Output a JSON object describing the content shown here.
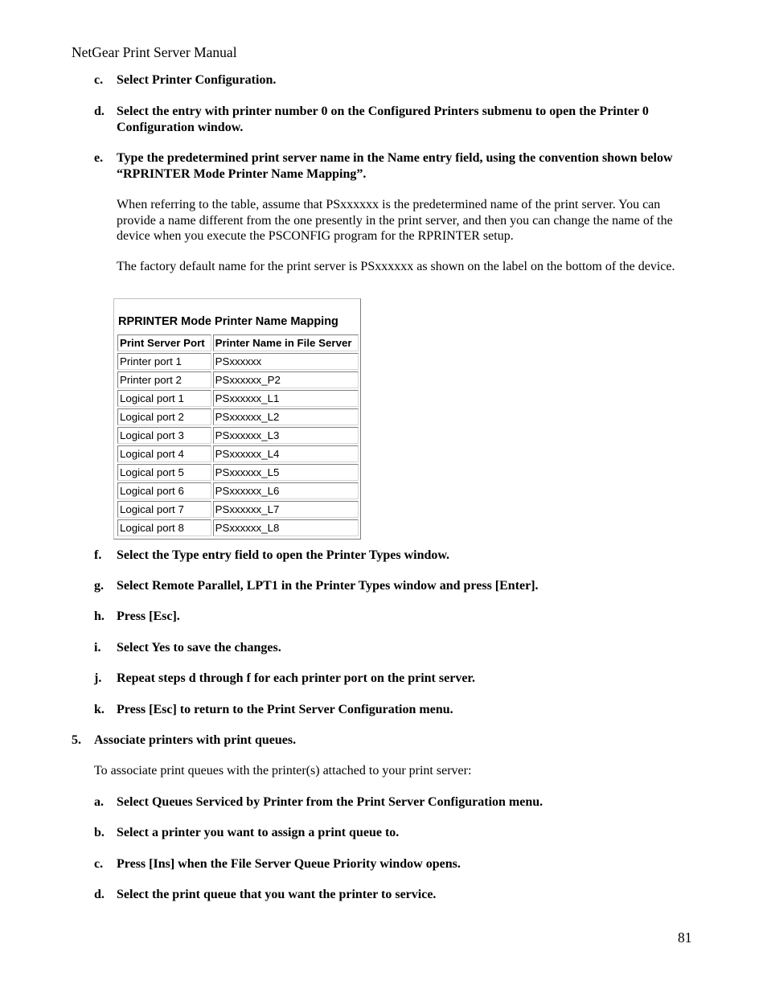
{
  "header": "NetGear Print Server Manual",
  "steps_top": [
    {
      "label": "c.",
      "text": "Select Printer Configuration."
    },
    {
      "label": "d.",
      "text": "Select the entry with printer number 0 on the Configured Printers submenu to open the Printer 0 Configuration window."
    },
    {
      "label": "e.",
      "text": "Type the predetermined print server name in the Name entry field, using the convention shown below “RPRINTER Mode Printer Name Mapping”."
    }
  ],
  "paragraphs": [
    "When referring to the table, assume that PSxxxxxx is the predetermined name of the print server. You can provide a name different from the one presently in the print server, and then you can change the name of the device when you execute the PSCONFIG program for the RPRINTER setup.",
    "The factory default name for the print server is PSxxxxxx as shown on the label on the bottom of the device."
  ],
  "table": {
    "title": "RPRINTER Mode Printer Name Mapping",
    "headers": [
      "Print Server Port",
      "Printer Name in File Server"
    ],
    "rows": [
      [
        "Printer port 1",
        "PSxxxxxx"
      ],
      [
        "Printer port 2",
        "PSxxxxxx_P2"
      ],
      [
        "Logical port 1",
        "PSxxxxxx_L1"
      ],
      [
        "Logical port 2",
        "PSxxxxxx_L2"
      ],
      [
        "Logical port 3",
        "PSxxxxxx_L3"
      ],
      [
        "Logical port 4",
        "PSxxxxxx_L4"
      ],
      [
        "Logical port 5",
        "PSxxxxxx_L5"
      ],
      [
        "Logical port 6",
        "PSxxxxxx_L6"
      ],
      [
        "Logical port 7",
        "PSxxxxxx_L7"
      ],
      [
        "Logical port 8",
        "PSxxxxxx_L8"
      ]
    ]
  },
  "steps_mid": [
    {
      "label": "f.",
      "text": "Select the Type entry field to open the Printer Types window."
    },
    {
      "label": "g.",
      "text": "Select Remote Parallel, LPT1 in the Printer Types window and press [Enter]."
    },
    {
      "label": "h.",
      "text": "Press [Esc]."
    },
    {
      "label": "i.",
      "text": "Select Yes to save the changes."
    },
    {
      "label": "j.",
      "text": "Repeat steps d through f for each printer port on the print server."
    },
    {
      "label": "k.",
      "text": "Press [Esc] to return to the Print Server Configuration menu."
    }
  ],
  "step5": {
    "label": "5.",
    "text": "Associate printers with print queues."
  },
  "step5_intro": "To associate print queues with the printer(s) attached to your print server:",
  "steps_bottom": [
    {
      "label": "a.",
      "text": "Select Queues Serviced by Printer from the Print Server Configuration menu."
    },
    {
      "label": "b.",
      "text": "Select a printer you want to assign a print queue to."
    },
    {
      "label": "c.",
      "text": "Press [Ins] when the File Server Queue Priority window opens."
    },
    {
      "label": "d.",
      "text": "Select the print queue that you want the printer to service."
    }
  ],
  "page_number": "81"
}
